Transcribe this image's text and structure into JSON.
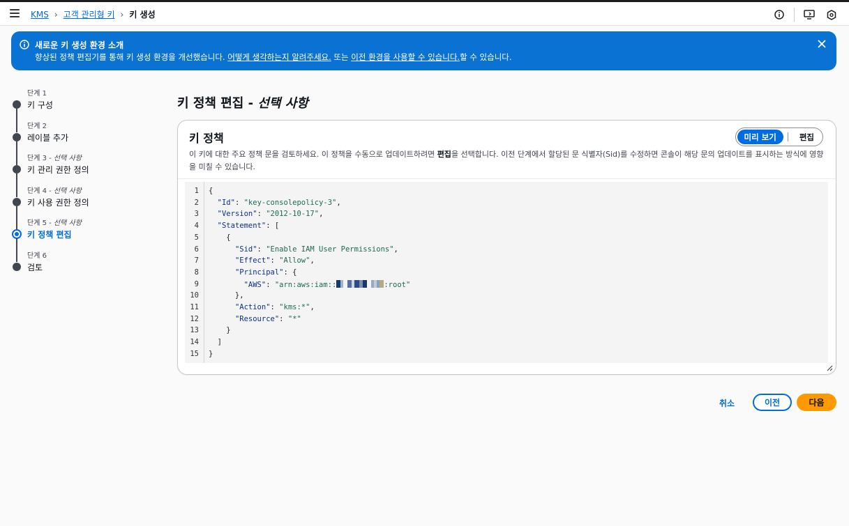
{
  "breadcrumb": {
    "items": [
      "KMS",
      "고객 관리형 키"
    ],
    "current": "키 생성"
  },
  "flash": {
    "title": "새로운 키 생성 환경 소개",
    "body_prefix": "향상된 정책 편집기를 통해 키 생성 환경을 개선했습니다. ",
    "link1": "어떻게 생각하는지 알려주세요.",
    "body_middle": " 또는 ",
    "link2": "이전 환경을 사용할 수 있습니다.",
    "body_suffix": "할 수 있습니다.",
    "color": "#0972d3"
  },
  "steps": [
    {
      "num": "단계 1",
      "optional": "",
      "label": "키 구성"
    },
    {
      "num": "단계 2",
      "optional": "",
      "label": "레이블 추가"
    },
    {
      "num": "단계 3 - ",
      "optional": "선택 사항",
      "label": "키 관리 권한 정의"
    },
    {
      "num": "단계 4 - ",
      "optional": "선택 사항",
      "label": "키 사용 권한 정의"
    },
    {
      "num": "단계 5 - ",
      "optional": "선택 사항",
      "label": "키 정책 편집",
      "active": true
    },
    {
      "num": "단계 6",
      "optional": "",
      "label": "검토"
    }
  ],
  "page": {
    "title": "키 정책 편집 - ",
    "title_optional": "선택 사항"
  },
  "panel": {
    "title": "키 정책",
    "desc_prefix": "이 키에 대한 주요 정책 문을 검토하세요. 이 정책을 수동으로 업데이트하려면 ",
    "desc_bold": "편집",
    "desc_suffix": "을 선택합니다. 이전 단계에서 할당된 문 식별자(Sid)를 수정하면 콘솔이 해당 문의 업데이트를 표시하는 방식에 영향을 미칠 수 있습니다.",
    "seg_preview": "미리 보기",
    "seg_edit": "편집"
  },
  "code": {
    "line_numbers": [
      "1",
      "2",
      "3",
      "4",
      "5",
      "6",
      "7",
      "8",
      "9",
      "10",
      "11",
      "12",
      "13",
      "14",
      "15"
    ],
    "id_value": "\"key-consolepolicy-3\"",
    "version_value": "\"2012-10-17\"",
    "sid_value": "\"Enable IAM User Permissions\"",
    "effect_value": "\"Allow\"",
    "aws_prefix": "\"arn:aws:iam::",
    "aws_suffix": ":root\"",
    "action_value": "\"kms:*\"",
    "resource_value": "\"*\""
  },
  "actions": {
    "cancel": "취소",
    "previous": "이전",
    "next": "다음"
  },
  "colors": {
    "accent": "#006ce0",
    "primary_button": "#ff9900"
  }
}
